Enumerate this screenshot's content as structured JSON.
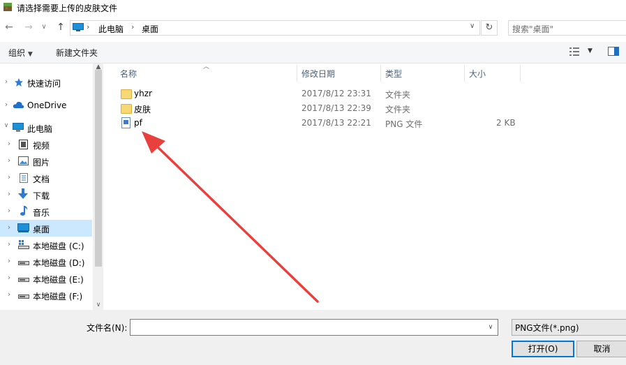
{
  "window": {
    "title": "请选择需要上传的皮肤文件"
  },
  "address": {
    "path": [
      "此电脑",
      "桌面"
    ],
    "search_placeholder": "搜索\"桌面\""
  },
  "toolbar": {
    "organize_label": "组织",
    "new_folder_label": "新建文件夹"
  },
  "nav": {
    "items": [
      {
        "label": "快速访问",
        "icon": "star-icon"
      },
      {
        "label": "OneDrive",
        "icon": "cloud-icon"
      },
      {
        "label": "此电脑",
        "icon": "computer-icon"
      },
      {
        "label": "视频",
        "icon": "video-icon"
      },
      {
        "label": "图片",
        "icon": "picture-icon"
      },
      {
        "label": "文档",
        "icon": "document-icon"
      },
      {
        "label": "下载",
        "icon": "download-icon"
      },
      {
        "label": "音乐",
        "icon": "music-icon"
      },
      {
        "label": "桌面",
        "icon": "desktop-icon"
      },
      {
        "label": "本地磁盘 (C:)",
        "icon": "drive-icon"
      },
      {
        "label": "本地磁盘 (D:)",
        "icon": "drive-icon"
      },
      {
        "label": "本地磁盘 (E:)",
        "icon": "drive-icon"
      },
      {
        "label": "本地磁盘 (F:)",
        "icon": "drive-icon"
      }
    ]
  },
  "files": {
    "columns": [
      "名称",
      "修改日期",
      "类型",
      "大小"
    ],
    "rows": [
      {
        "name": "yhzr",
        "date": "2017/8/12 23:31",
        "type": "文件夹",
        "size": ""
      },
      {
        "name": "皮肤",
        "date": "2017/8/13 22:39",
        "type": "文件夹",
        "size": ""
      },
      {
        "name": "pf",
        "date": "2017/8/13 22:21",
        "type": "PNG 文件",
        "size": "2 KB"
      }
    ]
  },
  "bottom": {
    "filename_label": "文件名(N):",
    "filename_value": "",
    "filter_value": "PNG文件(*.png)",
    "open_label": "打开(O)",
    "cancel_label": "取消"
  },
  "colors": {
    "annotation_arrow": "#e8403c",
    "selection": "#cce8ff",
    "accent": "#0078d7"
  }
}
